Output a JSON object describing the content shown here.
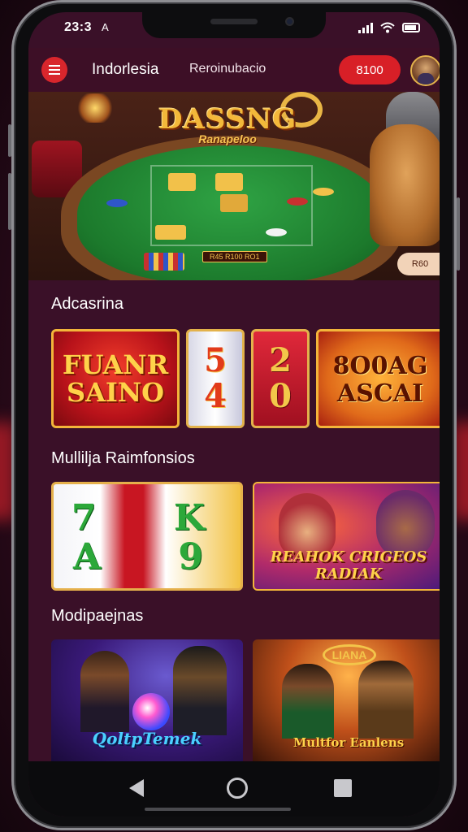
{
  "status_bar": {
    "time": "23:3",
    "extra": "A"
  },
  "header": {
    "title": "Indorlesia",
    "subtitle": "Reroinubacio",
    "cta_label": "8100"
  },
  "hero": {
    "title": "DASSNG",
    "subtitle": "Ranapeloo",
    "center_label": "R45 R100 RO1",
    "cta_label": "R60"
  },
  "sections": [
    {
      "title": "Adcasrina"
    },
    {
      "title": "Mullilja Raimfonsios"
    },
    {
      "title": "Modipaejnas"
    }
  ],
  "row1": [
    {
      "label": "FUANR SAINO"
    },
    {
      "label": "5 4"
    },
    {
      "label": "2 0"
    },
    {
      "label": "8O0AG ASCAI"
    }
  ],
  "row2": [
    {
      "label": "7 K A 9"
    },
    {
      "label": "REAHOK CRIGEOS   RADIAK"
    }
  ],
  "row3": [
    {
      "label": "QoltpTemek"
    },
    {
      "label": "Multfor Eanlens",
      "sign": "LIANA"
    }
  ],
  "colors": {
    "accent": "#d81f27",
    "background": "#3a1028",
    "header": "#3d0f26",
    "gold": "#f3b53a"
  },
  "icons": {
    "menu": "hamburger-icon",
    "back": "back-triangle-icon",
    "home": "home-circle-icon",
    "recent": "recent-square-icon"
  }
}
